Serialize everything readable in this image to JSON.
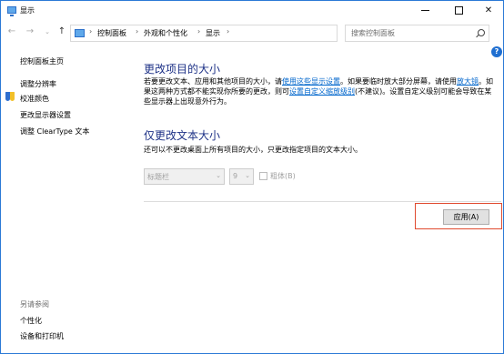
{
  "window": {
    "title": "显示",
    "controls": {
      "minimize": "—",
      "maximize": "☐",
      "close": "✕"
    }
  },
  "navigation": {
    "back_icon": "←",
    "forward_icon": "→",
    "recent_icon": "⌄",
    "up_icon": "↑",
    "breadcrumbs": [
      "控制面板",
      "外观和个性化",
      "显示"
    ],
    "separator": "›",
    "search_placeholder": "搜索控制面板",
    "dropdown_icon": "⌄",
    "refresh_icon": "↻",
    "help_icon": "?"
  },
  "sidebar": {
    "items": [
      {
        "label": "控制面板主页"
      },
      {
        "label": "调整分辨率"
      },
      {
        "label": "校准颜色"
      },
      {
        "label": "更改显示器设置"
      },
      {
        "label": "调整 ClearType 文本"
      }
    ],
    "see_also_label": "另请参阅",
    "see_also": [
      {
        "label": "个性化"
      },
      {
        "label": "设备和打印机"
      }
    ]
  },
  "main": {
    "section1": {
      "title": "更改项目的大小",
      "text_1": "若要更改文本、应用和其他项目的大小，请",
      "link_1": "使用这些显示设置",
      "text_2": "。如果要临时放大部分屏幕，请使用",
      "link_2": "放大镜",
      "text_3": "。如果这两种方式都不能实现你所要的更改，则可",
      "link_3": "设置自定义缩放级别",
      "text_4": "(不建议)。设置自定义级别可能会导致在某些显示器上出现意外行为。"
    },
    "section2": {
      "title": "仅更改文本大小",
      "description": "还可以不更改桌面上所有项目的大小，只更改指定项目的文本大小。",
      "item_select_value": "标题栏",
      "size_select_value": "9",
      "select_arrow": "⌄",
      "bold_label": "粗体(B)",
      "bold_checked": false
    },
    "apply_button": "应用(A)"
  },
  "colors": {
    "heading": "#1e3287",
    "link": "#0066cc",
    "highlight_border": "#e04a2f",
    "window_border": "#2b79d6"
  }
}
